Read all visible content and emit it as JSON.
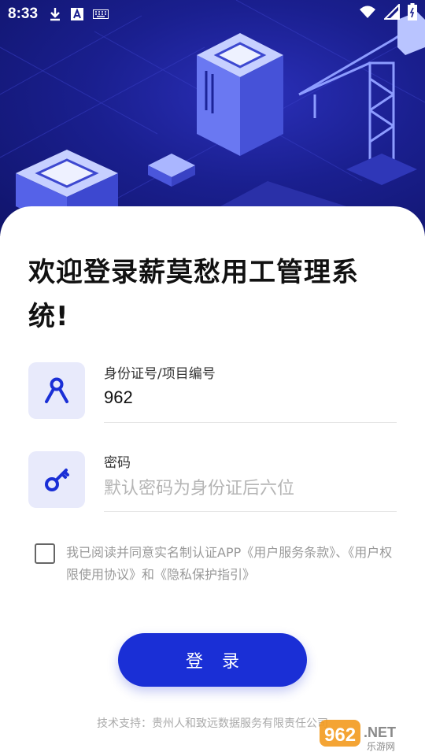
{
  "status_bar": {
    "time": "8:33",
    "icons": [
      "download-icon",
      "font-a-icon",
      "keyboard-icon",
      "wifi-icon",
      "signal-icon",
      "battery-icon"
    ]
  },
  "welcome_title": "欢迎登录薪莫愁用工管理系统!",
  "id_field": {
    "label": "身份证号/项目编号",
    "value": "962"
  },
  "password_field": {
    "label": "密码",
    "placeholder": "默认密码为身份证后六位",
    "value": ""
  },
  "agreement": {
    "checked": false,
    "text": "我已阅读并同意实名制认证APP《用户服务条款》、《用户权限使用协议》和《隐私保护指引》"
  },
  "login_button": "登录",
  "footer": "技术支持：贵州人和致远数据服务有限责任公司",
  "watermark": {
    "brand": "962.NET",
    "sub": "乐游网"
  },
  "colors": {
    "primary": "#1a2fd6",
    "hero_bg": "#1a1f8f",
    "icon_bg": "#e8eafb"
  }
}
